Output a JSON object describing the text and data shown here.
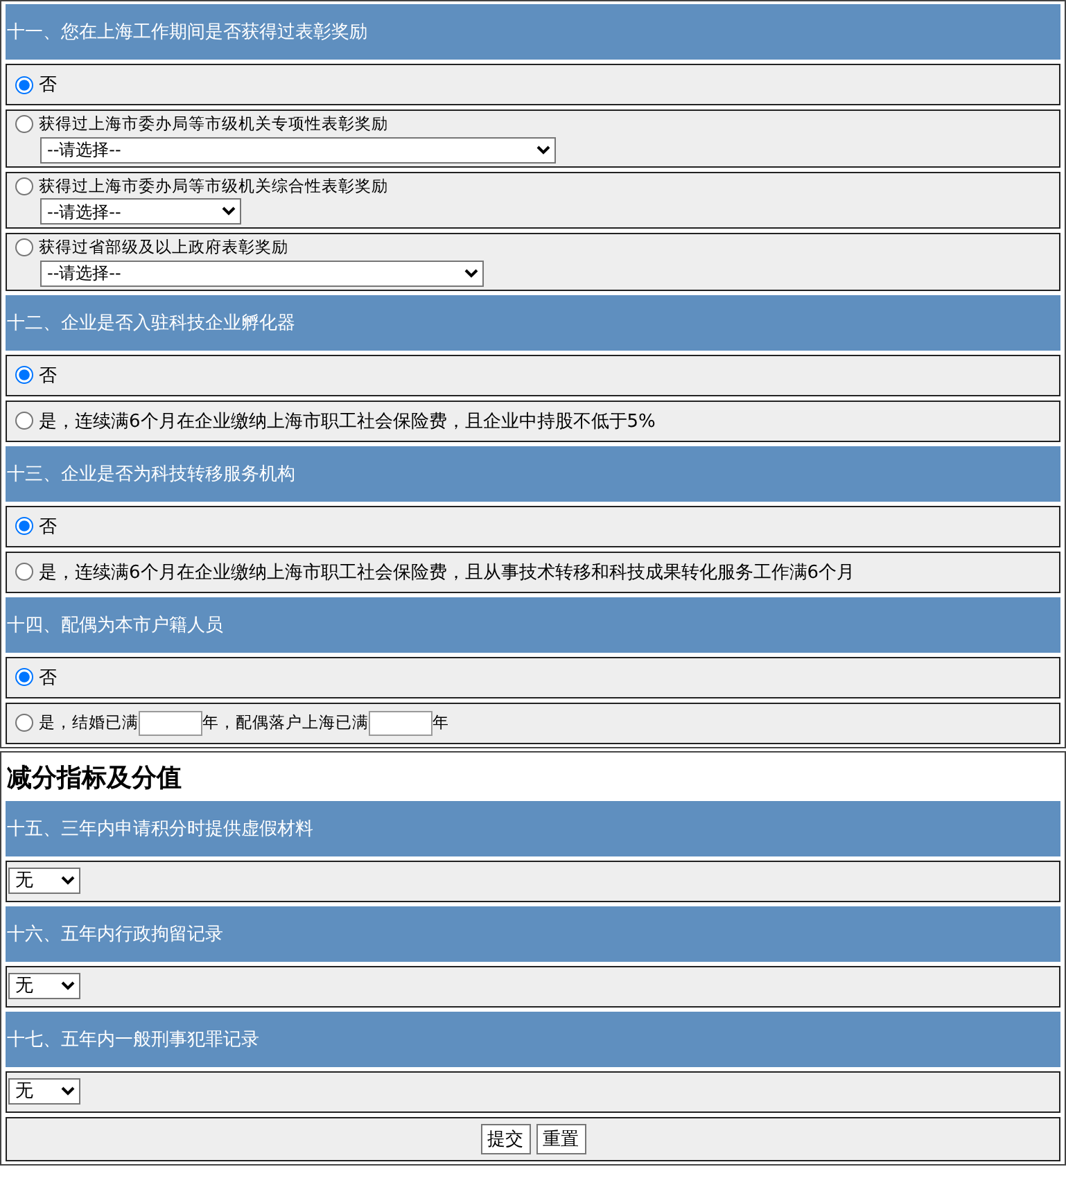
{
  "groups": [
    {
      "sections": [
        {
          "title": "十一、您在上海工作期间是否获得过表彰奖励",
          "options": [
            {
              "kind": "radio",
              "label": "否",
              "selected": true
            },
            {
              "kind": "radio_select",
              "label": "获得过上海市委办局等市级机关专项性表彰奖励",
              "selected": false,
              "select": "--请选择--"
            },
            {
              "kind": "radio_select",
              "label": "获得过上海市委办局等市级机关综合性表彰奖励",
              "selected": false,
              "select": "--请选择--"
            },
            {
              "kind": "radio_select",
              "label": "获得过省部级及以上政府表彰奖励",
              "selected": false,
              "select": "--请选择--"
            }
          ]
        },
        {
          "title": "十二、企业是否入驻科技企业孵化器",
          "options": [
            {
              "kind": "radio",
              "label": "否",
              "selected": true
            },
            {
              "kind": "radio",
              "label": "是，连续满6个月在企业缴纳上海市职工社会保险费，且企业中持股不低于5%",
              "selected": false
            }
          ]
        },
        {
          "title": "十三、企业是否为科技转移服务机构",
          "options": [
            {
              "kind": "radio",
              "label": "否",
              "selected": true
            },
            {
              "kind": "radio",
              "label": "是，连续满6个月在企业缴纳上海市职工社会保险费，且从事技术转移和科技成果转化服务工作满6个月",
              "selected": false
            }
          ]
        },
        {
          "title": "十四、配偶为本市户籍人员",
          "options": [
            {
              "kind": "radio",
              "label": "否",
              "selected": true
            },
            {
              "kind": "radio_fields",
              "selected": false,
              "parts": [
                {
                  "kind": "text",
                  "text": "是，结婚已满"
                },
                {
                  "kind": "field"
                },
                {
                  "kind": "text",
                  "text": "年，配偶落户上海已满"
                },
                {
                  "kind": "field"
                },
                {
                  "kind": "text",
                  "text": "年"
                }
              ]
            }
          ]
        }
      ]
    },
    {
      "heading": "减分指标及分值",
      "sections": [
        {
          "title": "十五、三年内申请积分时提供虚假材料",
          "options": [
            {
              "kind": "select",
              "select": "无"
            }
          ]
        },
        {
          "title": "十六、五年内行政拘留记录",
          "options": [
            {
              "kind": "select",
              "select": "无"
            }
          ]
        },
        {
          "title": "十七、五年内一般刑事犯罪记录",
          "options": [
            {
              "kind": "select",
              "select": "无"
            }
          ]
        }
      ],
      "buttons": [
        "提交",
        "重置"
      ]
    }
  ]
}
